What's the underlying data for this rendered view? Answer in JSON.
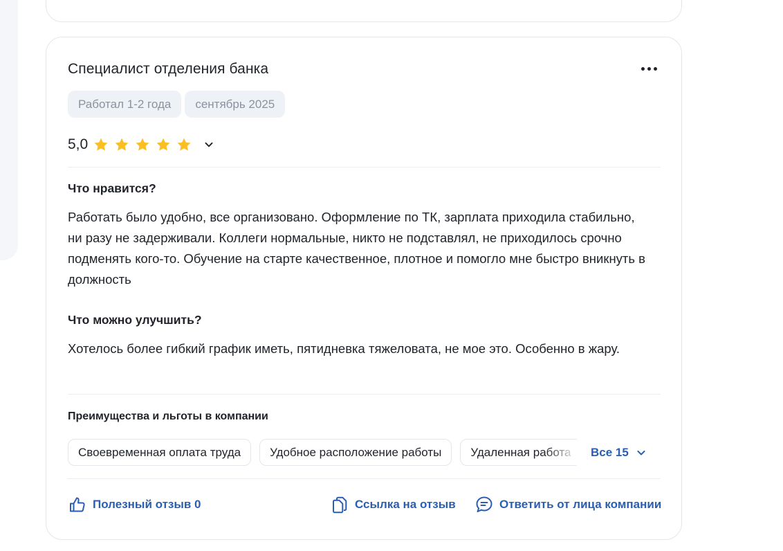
{
  "review": {
    "title": "Специалист отделения банка",
    "tags": [
      "Работал 1-2 года",
      "сентябрь 2025"
    ],
    "rating": {
      "value": "5,0",
      "stars": 5,
      "star_color": "#fbbf24"
    },
    "likes": {
      "heading": "Что нравится?",
      "text": "Работать было удобно, все организовано. Оформление по ТК, зарплата приходила стабильно, ни разу не задерживали. Коллеги нормальные, никто не подставлял, не приходилось срочно подменять кого-то. Обучение на старте качественное, плотное и помогло мне быстро вникнуть в должность"
    },
    "improve": {
      "heading": "Что можно улучшить?",
      "text": "Хотелось более гибкий график иметь, пятидневка тяжеловата, не мое это. Особенно в жару."
    },
    "benefits": {
      "title": "Преимущества и льготы в компании",
      "items": [
        "Своевременная оплата труда",
        "Удобное расположение работы",
        "Удаленная работа"
      ],
      "see_all": "Все 15"
    },
    "actions": {
      "helpful": "Полезный отзыв 0",
      "link": "Ссылка на отзыв",
      "reply": "Ответить от лица компании"
    }
  },
  "colors": {
    "accent": "#2a5eb0",
    "text": "#1f2329",
    "muted": "#8a92a0",
    "tag_bg": "#eef1f5",
    "border": "#e3e6eb"
  }
}
